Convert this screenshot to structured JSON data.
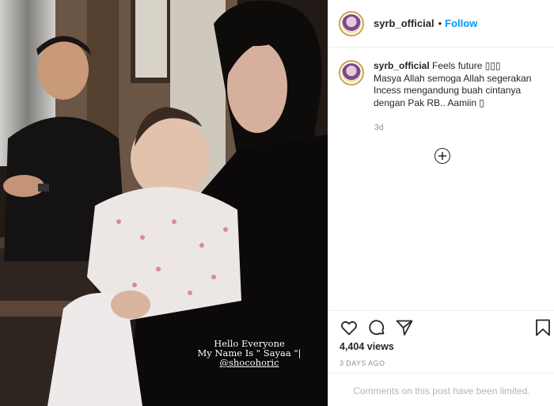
{
  "post": {
    "username": "syrb_official",
    "follow_label": "Follow",
    "separator": "•",
    "caption_lines": [
      "Feels future ▯▯▯",
      "Masya Allah semoga Allah segerakan",
      "Incess mengandung buah cintanya",
      "dengan Pak RB.. Aamiin ▯"
    ],
    "caption_time": "3d",
    "views": "4,404 views",
    "date": "3 DAYS AGO",
    "comments_limited": "Comments on this post have been limited."
  },
  "video": {
    "overlay_line1": "Hello Everyone",
    "overlay_line2": "My Name Is \" Sayaa \"|",
    "overlay_handle": "@shocohoric"
  },
  "icons": {
    "like": "heart-icon",
    "comment": "comment-icon",
    "share": "paper-plane-icon",
    "save": "bookmark-icon",
    "load_more": "plus-circle-icon"
  },
  "colors": {
    "follow": "#0095f6",
    "text": "#262626",
    "muted": "#8e8e8e",
    "border": "#efefef"
  }
}
